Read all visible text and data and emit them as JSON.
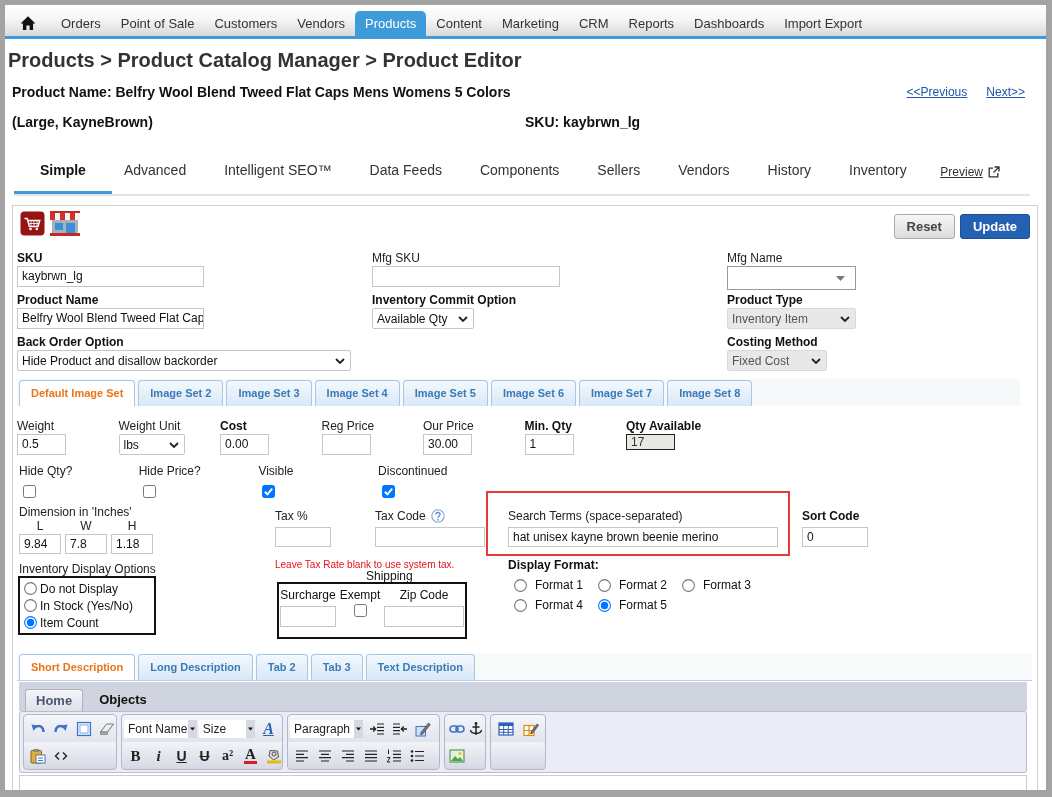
{
  "nav": [
    {
      "label": "Orders",
      "selected": false
    },
    {
      "label": "Point of Sale",
      "selected": false
    },
    {
      "label": "Customers",
      "selected": false
    },
    {
      "label": "Vendors",
      "selected": false
    },
    {
      "label": "Products",
      "selected": true
    },
    {
      "label": "Content",
      "selected": false
    },
    {
      "label": "Marketing",
      "selected": false
    },
    {
      "label": "CRM",
      "selected": false
    },
    {
      "label": "Reports",
      "selected": false
    },
    {
      "label": "Dashboards",
      "selected": false
    },
    {
      "label": "Import Export",
      "selected": false
    }
  ],
  "breadcrumb": "Products > Product Catalog Manager > Product Editor",
  "product": {
    "name": "Product Name: Belfry Wool Blend Tweed Flat Caps Mens Womens 5 Colors",
    "variant": "(Large, KayneBrown)",
    "sku": "SKU: kaybrwn_lg"
  },
  "pager": {
    "previous": "<<Previous",
    "next": "Next>>"
  },
  "tabs": [
    {
      "label": "Simple",
      "selected": true
    },
    {
      "label": "Advanced",
      "selected": false
    },
    {
      "label": "Intelligent SEO™",
      "selected": false
    },
    {
      "label": "Data Feeds",
      "selected": false
    },
    {
      "label": "Components",
      "selected": false
    },
    {
      "label": "Sellers",
      "selected": false
    },
    {
      "label": "Vendors",
      "selected": false
    },
    {
      "label": "History",
      "selected": false
    },
    {
      "label": "Inventory",
      "selected": false
    }
  ],
  "preview": "Preview",
  "actions": [
    {
      "label": "Reset",
      "kind": "secondary"
    },
    {
      "label": "Update",
      "kind": "primary"
    }
  ],
  "main_fields": [
    {
      "fields": [
        {
          "label": "SKU",
          "required": true,
          "kind": "text",
          "value": "kaybrwn_lg",
          "disabled": false
        },
        {
          "label": "Product Name",
          "required": true,
          "kind": "text",
          "value": "Belfry Wool Blend Tweed Flat Cap",
          "disabled": false
        },
        {
          "label": "Back Order Option",
          "required": true,
          "kind": "select",
          "value": "Hide Product and disallow backorder",
          "disabled": false
        }
      ]
    },
    {
      "fields": [
        {
          "label": "Mfg SKU",
          "required": false,
          "kind": "text",
          "disabled": false
        },
        {
          "label": "Inventory Commit Option",
          "required": true,
          "kind": "select",
          "value": "Available Qty",
          "disabled": false
        }
      ]
    },
    {
      "fields": [
        {
          "label": "Mfg Name",
          "required": false,
          "kind": "combo",
          "disabled": false
        },
        {
          "label": "Product Type",
          "required": true,
          "kind": "select",
          "value": "Inventory Item",
          "disabled": true
        },
        {
          "label": "Costing Method",
          "required": true,
          "kind": "select",
          "value": "Fixed Cost",
          "disabled": true
        }
      ]
    }
  ],
  "image_tabs": [
    {
      "label": "Default Image Set",
      "selected": true
    },
    {
      "label": "Image Set 2",
      "selected": false
    },
    {
      "label": "Image Set 3",
      "selected": false
    },
    {
      "label": "Image Set 4",
      "selected": false
    },
    {
      "label": "Image Set 5",
      "selected": false
    },
    {
      "label": "Image Set 6",
      "selected": false
    },
    {
      "label": "Image Set 7",
      "selected": false
    },
    {
      "label": "Image Set 8",
      "selected": false
    }
  ],
  "price_fields": [
    {
      "label": "Weight",
      "required": false,
      "kind": "text",
      "value": "0.5"
    },
    {
      "label": "Weight Unit",
      "required": false,
      "kind": "select",
      "value": "lbs"
    },
    {
      "label": "Cost",
      "required": true,
      "kind": "text",
      "value": "0.00"
    },
    {
      "label": "Reg Price",
      "required": false,
      "kind": "text"
    },
    {
      "label": "Our Price",
      "required": false,
      "kind": "text",
      "value": "30.00"
    },
    {
      "label": "Min. Qty",
      "required": true,
      "kind": "text",
      "value": "1"
    },
    {
      "label": "Qty Available",
      "required": true,
      "kind": "readonly",
      "value": "17"
    }
  ],
  "flags": [
    {
      "label": "Hide Qty?",
      "checked": false
    },
    {
      "label": "Hide Price?",
      "checked": false
    },
    {
      "label": "Visible",
      "checked": true
    },
    {
      "label": "Discontinued",
      "checked": true
    }
  ],
  "dimensions": {
    "label": "Dimension in 'Inches'",
    "fields": [
      {
        "label": "L",
        "value": "9.84"
      },
      {
        "label": "W",
        "value": "7.8"
      },
      {
        "label": "H",
        "value": "1.18"
      }
    ]
  },
  "inventory_display": {
    "label": "Inventory Display Options",
    "options": [
      {
        "label": "Do not Display",
        "selected": false
      },
      {
        "label": "In Stock (Yes/No)",
        "selected": false
      },
      {
        "label": "Item Count",
        "selected": true
      }
    ]
  },
  "tax": {
    "fields": [
      {
        "label": "Tax %",
        "help": false
      },
      {
        "label": "Tax Code",
        "help": true
      }
    ],
    "note": "Leave Tax Rate blank to use system tax."
  },
  "shipping": {
    "title": "Shipping",
    "surcharge": {
      "label": "Surcharge"
    },
    "exempt": {
      "label": "Exempt",
      "checked": false
    },
    "zip": {
      "label": "Zip Code"
    }
  },
  "search_terms": {
    "label": "Search Terms (space-separated)",
    "value": "hat unisex kayne brown beenie merino",
    "highlighted": true
  },
  "sort_code": {
    "label": "Sort Code",
    "required": true,
    "value": "0"
  },
  "display_format": {
    "label": "Display Format:",
    "options": [
      {
        "label": "Format 1",
        "selected": false
      },
      {
        "label": "Format 2",
        "selected": false
      },
      {
        "label": "Format 3",
        "selected": false
      },
      {
        "label": "Format 4",
        "selected": false
      },
      {
        "label": "Format 5",
        "selected": true
      }
    ]
  },
  "description_tabs": [
    {
      "label": "Short Description",
      "selected": true
    },
    {
      "label": "Long Description",
      "selected": false
    },
    {
      "label": "Tab 2",
      "selected": false
    },
    {
      "label": "Tab 3",
      "selected": false
    },
    {
      "label": "Text Description",
      "selected": false
    }
  ],
  "editor": {
    "tabs": [
      {
        "label": "Home",
        "selected": true
      },
      {
        "label": "Objects",
        "selected": false
      }
    ],
    "font_name": "Font Name",
    "size": "Size",
    "paragraph": "Paragraph",
    "style_button": {
      "kind": "style",
      "text": "A"
    },
    "format_buttons": [
      {
        "kind": "bold",
        "text": "B"
      },
      {
        "kind": "italic",
        "text": "i"
      },
      {
        "kind": "underline",
        "text": "U"
      },
      {
        "kind": "strike",
        "text": "U"
      },
      {
        "kind": "superscript",
        "text": "a²"
      },
      {
        "kind": "color",
        "text": "A"
      }
    ]
  }
}
